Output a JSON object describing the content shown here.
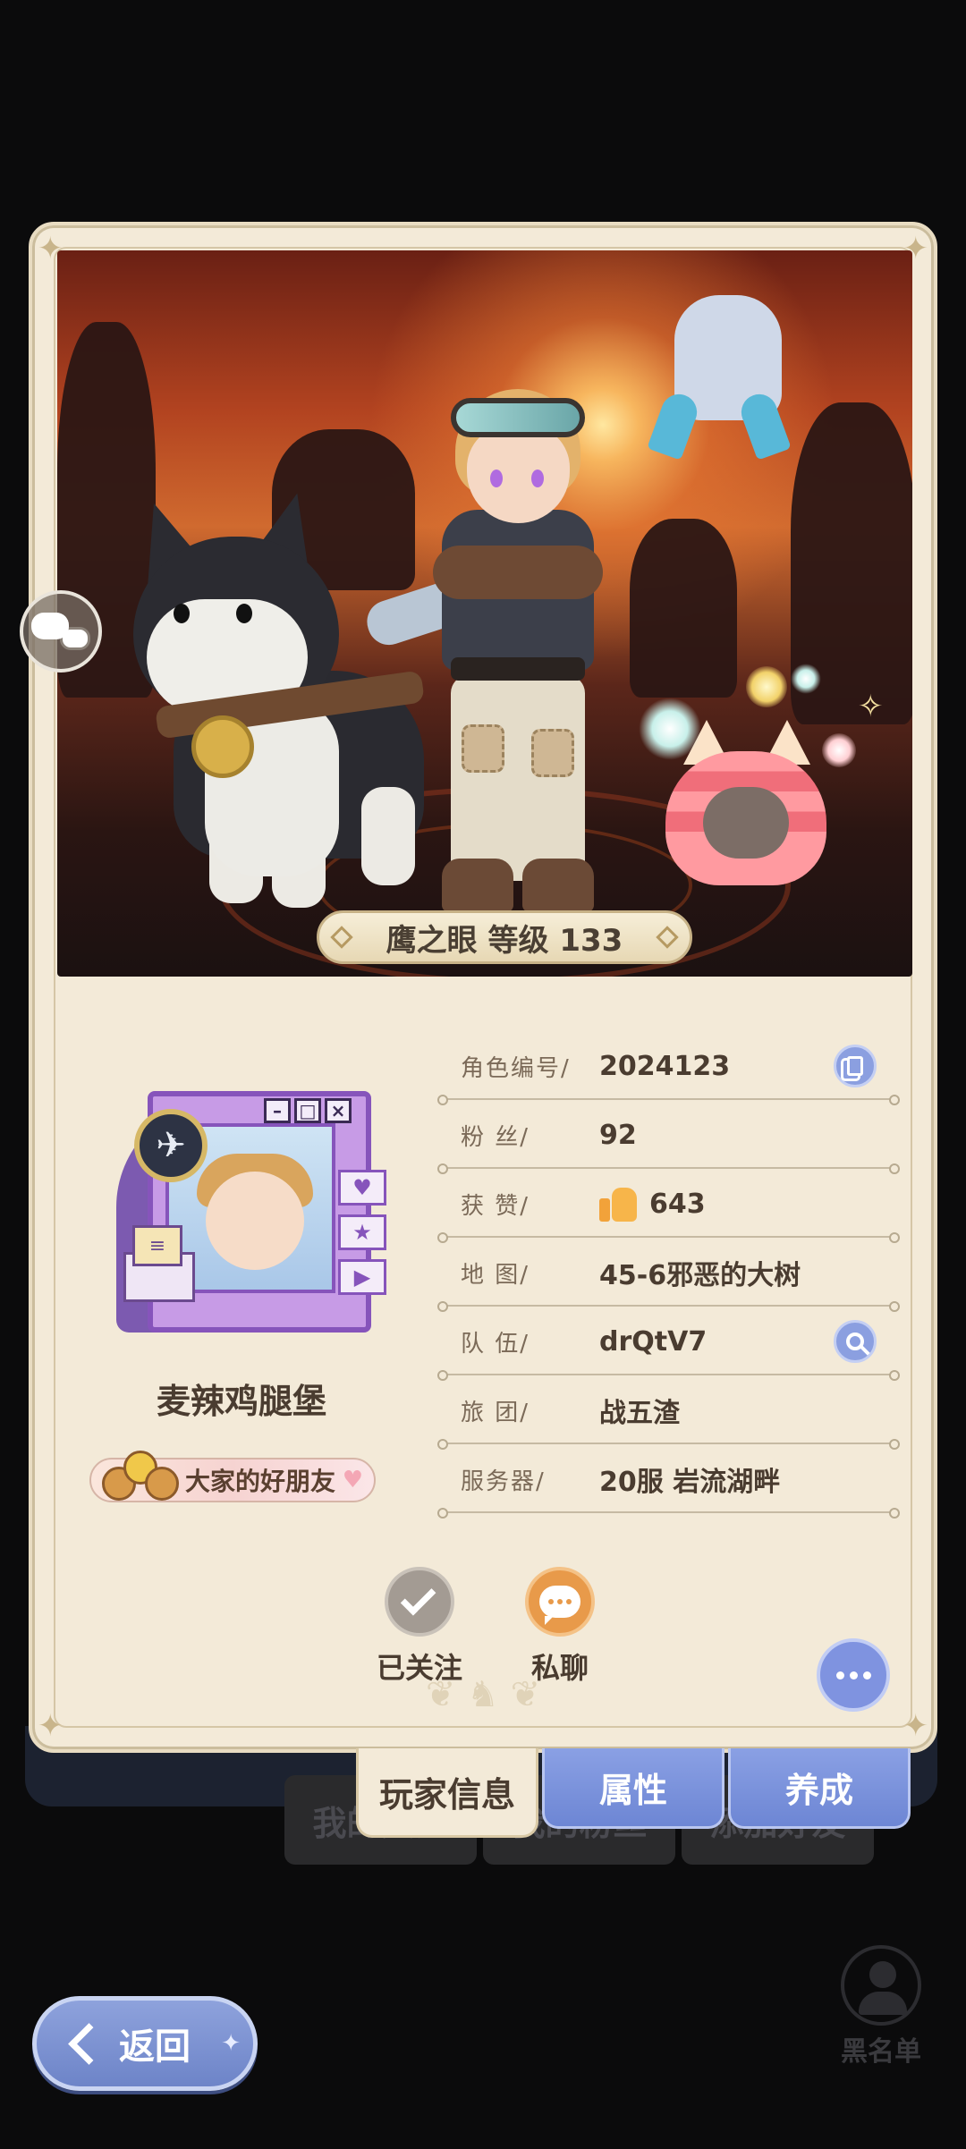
{
  "background": {
    "tabs": [
      "我的关注",
      "我的粉丝",
      "添加好友"
    ],
    "blacklist_label": "黑名单"
  },
  "profile": {
    "nameplate": "鹰之眼 等级 133",
    "player_name": "麦辣鸡腿堡",
    "title_badge": "大家的好朋友",
    "info": [
      {
        "label": "角色编号/",
        "value": "2024123",
        "action_icon": "copy-icon"
      },
      {
        "label": "粉  丝/",
        "value": "92"
      },
      {
        "label": "获  赞/",
        "value": "643",
        "icon": "thumbs-up-icon"
      },
      {
        "label": "地  图/",
        "value": "45-6邪恶的大树"
      },
      {
        "label": "队  伍/",
        "value": "drQtV7",
        "action_icon": "search-icon"
      },
      {
        "label": "旅  团/",
        "value": "战五渣"
      },
      {
        "label": "服务器/",
        "value": "20服  岩流湖畔"
      }
    ],
    "actions": {
      "follow_label": "已关注",
      "chat_label": "私聊"
    }
  },
  "tabs": {
    "player_info": "玩家信息",
    "attributes": "属性",
    "training": "养成"
  },
  "back_button": {
    "label": "返回"
  },
  "colors": {
    "card_bg": "#f3ead8",
    "accent_blue": "#7f93e0",
    "accent_orange": "#e89a4a",
    "text_dark": "#4a3c30"
  }
}
